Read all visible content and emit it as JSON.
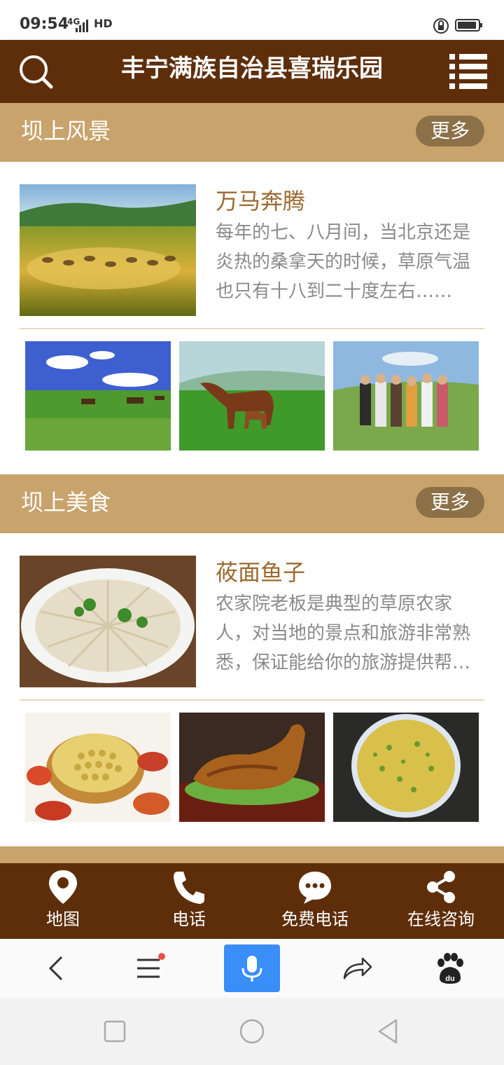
{
  "status_bar": {
    "time": "09:54",
    "network": "4G",
    "hd": "HD"
  },
  "header": {
    "title": "丰宁满族自治县喜瑞乐园"
  },
  "sections": [
    {
      "title": "坝上风景",
      "more_label": "更多",
      "feature": {
        "title": "万马奔腾",
        "description": "每年的七、八月间，当北京还是炎热的桑拿天的时候，草原气温也只有十八到二十度左右……"
      }
    },
    {
      "title": "坝上美食",
      "more_label": "更多",
      "feature": {
        "title": "莜面鱼子",
        "description": "农家院老板是典型的草原农家人，对当地的景点和旅游非常熟悉，保证能给你的旅游提供帮助……"
      }
    }
  ],
  "contact_bar": {
    "items": [
      {
        "label": "地图",
        "icon": "map-pin-icon"
      },
      {
        "label": "电话",
        "icon": "phone-icon"
      },
      {
        "label": "免费电话",
        "icon": "chat-bubble-icon"
      },
      {
        "label": "在线咨询",
        "icon": "share-icon"
      }
    ]
  },
  "browser_bar": {
    "icons": [
      "back-arrow-icon",
      "menu-icon",
      "microphone-icon",
      "forward-share-icon",
      "baidu-paw-icon"
    ]
  },
  "colors": {
    "header_bg": "#5e2e0b",
    "section_bar": "#c9a36c",
    "more_button": "#8c7048",
    "feature_title": "#9a6a2e",
    "voice_button": "#3a8ef7"
  }
}
